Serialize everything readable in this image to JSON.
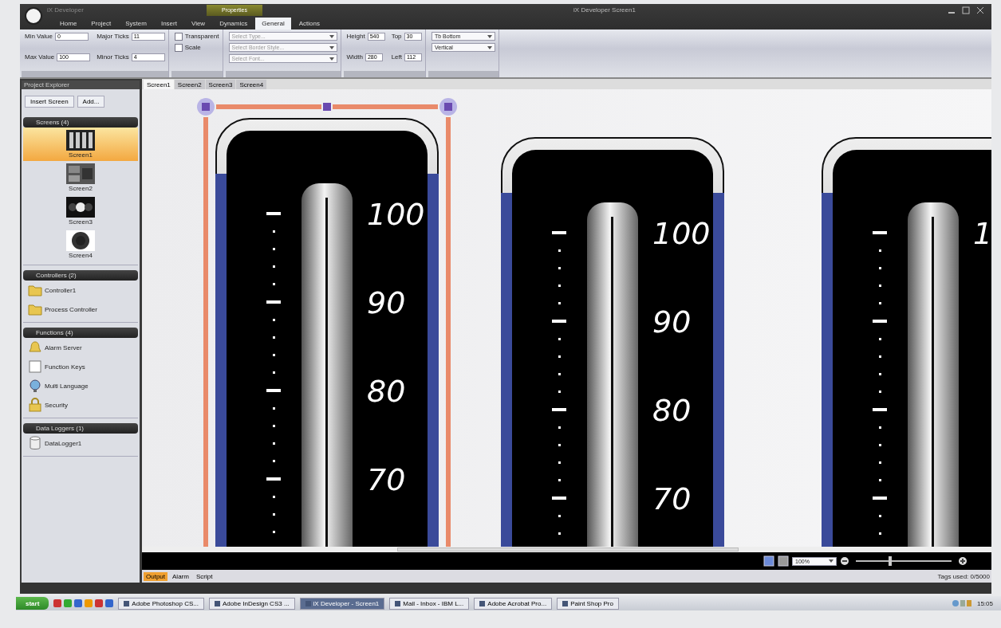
{
  "window": {
    "title": "iX Developer Screen1"
  },
  "quick_access": {
    "title": "iX Developer"
  },
  "menu": [
    {
      "label": "Home",
      "selected": false
    },
    {
      "label": "Project",
      "selected": false
    },
    {
      "label": "System",
      "selected": false
    },
    {
      "label": "Insert",
      "selected": false
    },
    {
      "label": "View",
      "selected": false
    },
    {
      "label": "Dynamics",
      "selected": false
    }
  ],
  "context_group": {
    "title": "Properties",
    "tabs": [
      {
        "label": "General",
        "selected": true
      },
      {
        "label": "Actions",
        "selected": false
      }
    ]
  },
  "ribbon": {
    "fields": [
      {
        "label": "Min Value",
        "value": "0"
      },
      {
        "label": "Major Ticks",
        "value": "11"
      },
      {
        "label": "Max Value",
        "value": "100"
      },
      {
        "label": "Minor Ticks",
        "value": "4"
      }
    ],
    "checkboxes": [
      {
        "label": "Transparent",
        "checked": false
      },
      {
        "label": "Scale",
        "checked": false
      }
    ],
    "dropdowns": [
      {
        "placeholder": "Select Type..."
      },
      {
        "placeholder": "Select Border Style..."
      },
      {
        "placeholder": "Select Font..."
      }
    ],
    "position": [
      {
        "label": "Height",
        "value": "540"
      },
      {
        "label": "Top",
        "value": "30"
      },
      {
        "label": "Width",
        "value": "280"
      },
      {
        "label": "Left",
        "value": "112"
      }
    ],
    "layout_dropdowns": [
      {
        "value": "Tb Bottom"
      },
      {
        "value": "Vertical"
      }
    ]
  },
  "explorer": {
    "title": "Project Explorer",
    "buttons": [
      {
        "label": "Insert Screen"
      },
      {
        "label": "Add..."
      }
    ],
    "sections": [
      {
        "title": "Screens (4)",
        "items": [
          {
            "kind": "thumbnail",
            "label": "Screen1",
            "selected": true
          },
          {
            "kind": "thumbnail",
            "label": "Screen2",
            "selected": false
          },
          {
            "kind": "thumbnail",
            "label": "Screen3",
            "selected": false
          },
          {
            "kind": "thumbnail",
            "label": "Screen4",
            "selected": false
          }
        ]
      },
      {
        "title": "Controllers (2)",
        "items": [
          {
            "kind": "folder",
            "label": "Controller1",
            "selected": false
          },
          {
            "kind": "folder",
            "label": "Process Controller",
            "selected": false
          }
        ]
      },
      {
        "title": "Functions (4)",
        "items": [
          {
            "kind": "bell",
            "label": "Alarm Server",
            "selected": false
          },
          {
            "kind": "fkey",
            "label": "Function Keys",
            "selected": false
          },
          {
            "kind": "globe",
            "label": "Multi Language",
            "selected": false
          },
          {
            "kind": "lock",
            "label": "Security",
            "selected": false
          }
        ]
      },
      {
        "title": "Data Loggers (1)",
        "items": [
          {
            "kind": "database",
            "label": "DataLogger1",
            "selected": false
          }
        ]
      }
    ]
  },
  "document_tabs": [
    {
      "label": "Screen1",
      "selected": true
    },
    {
      "label": "Screen2",
      "selected": false
    },
    {
      "label": "Screen3",
      "selected": false
    },
    {
      "label": "Screen4",
      "selected": false
    }
  ],
  "gauges": [
    {
      "selected": true,
      "labels": [
        "100",
        "90",
        "80",
        "70"
      ]
    },
    {
      "selected": false,
      "labels": [
        "100",
        "90",
        "80",
        "70"
      ]
    },
    {
      "selected": false,
      "labels": [
        "1"
      ]
    }
  ],
  "zoom_bar": {
    "zoom": "100%",
    "level": 0.36
  },
  "output_tabs": [
    {
      "label": "Output",
      "selected": true
    },
    {
      "label": "Alarm",
      "selected": false
    },
    {
      "label": "Script",
      "selected": false
    }
  ],
  "status": "Tags used: 0/5000",
  "taskbar": {
    "start": "start",
    "apps": [
      {
        "label": "Adobe Photoshop CS...",
        "selected": false
      },
      {
        "label": "Adobe InDesign CS3 ...",
        "selected": false
      },
      {
        "label": "iX Developer - Screen1",
        "selected": true
      },
      {
        "label": "Mail - Inbox - IBM L...",
        "selected": false
      },
      {
        "label": "Adobe Acrobat Pro...",
        "selected": false
      },
      {
        "label": "Paint Shop Pro",
        "selected": false
      }
    ],
    "clock": "15:05"
  }
}
